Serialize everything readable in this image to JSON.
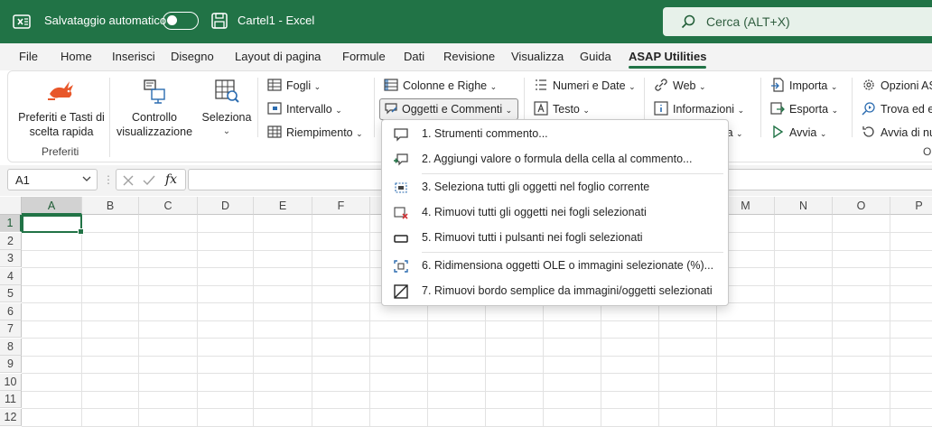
{
  "titlebar": {
    "autosave_label": "Salvataggio automatico",
    "doc_title": "Cartel1  -  Excel",
    "search_placeholder": "Cerca (ALT+X)",
    "bg_color": "#217346"
  },
  "menu_tabs": [
    "File",
    "Home",
    "Inserisci",
    "Disegno",
    "Layout di pagina",
    "Formule",
    "Dati",
    "Revisione",
    "Visualizza",
    "Guida",
    "ASAP Utilities"
  ],
  "active_tab": "ASAP Utilities",
  "ribbon": {
    "favorites_label_1": "Preferiti e Tasti di",
    "favorites_label_2": "scelta rapida",
    "favorites_group": "Preferiti",
    "control_label_1": "Controllo",
    "control_label_2": "visualizzazione",
    "select_label": "Seleziona",
    "fogli": "Fogli",
    "intervallo": "Intervallo",
    "riempimento": "Riempimento",
    "colonne_righe": "Colonne e Righe",
    "oggetti_commenti": "Oggetti e Commenti",
    "numeri_date": "Numeri e Date",
    "testo": "Testo",
    "web": "Web",
    "informazioni": "Informazioni",
    "info_partial": "rma",
    "importa": "Importa",
    "esporta": "Esporta",
    "avvia": "Avvia",
    "opzioni": "Opzioni ASA",
    "trova": "Trova ed es",
    "avvia_nuovo": "Avvia di nu",
    "right_group_partial": "O"
  },
  "formula_bar": {
    "namebox": "A1",
    "fx": "fx"
  },
  "grid": {
    "columns": [
      "A",
      "B",
      "C",
      "D",
      "E",
      "F",
      "G",
      "H",
      "I",
      "J",
      "K",
      "L",
      "M",
      "N",
      "O",
      "P"
    ],
    "rows": [
      "1",
      "2",
      "3",
      "4",
      "5",
      "6",
      "7",
      "8",
      "9",
      "10",
      "11",
      "12"
    ],
    "active_cell": "A1"
  },
  "dropdown": {
    "items": [
      "1. Strumenti commento...",
      "2. Aggiungi valore o formula della cella al commento...",
      "3. Seleziona tutti gli oggetti nel foglio corrente",
      "4. Rimuovi tutti gli oggetti nei fogli selezionati",
      "5. Rimuovi tutti i pulsanti nei fogli selezionati",
      "6. Ridimensiona oggetti OLE o immagini selezionate (%)...",
      "7. Rimuovi bordo semplice da immagini/oggetti selezionati"
    ]
  }
}
